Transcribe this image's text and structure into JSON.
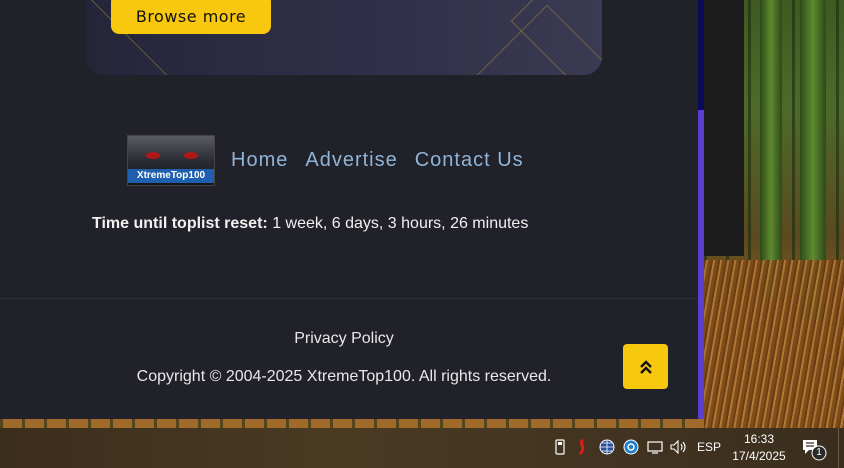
{
  "banner": {
    "button_label": "Browse more"
  },
  "footer_nav": {
    "logo_text": "XtremeTop100",
    "links": [
      "Home",
      "Advertise",
      "Contact Us"
    ]
  },
  "reset": {
    "label": "Time until toplist reset:",
    "value": "1 week, 6 days, 3 hours, 26 minutes"
  },
  "footer": {
    "privacy": "Privacy Policy",
    "copyright": "Copyright © 2004-2025 XtremeTop100. All rights reserved."
  },
  "taskbar": {
    "language": "ESP",
    "time": "16:33",
    "date": "17/4/2025",
    "notification_count": "1",
    "tray_icons": [
      "usb-icon",
      "antivirus-icon",
      "network-globe-icon",
      "sync-icon",
      "display-icon",
      "volume-icon"
    ]
  },
  "colors": {
    "accent": "#f7c80d",
    "page_bg": "#212129",
    "link": "#8fb4d8"
  }
}
